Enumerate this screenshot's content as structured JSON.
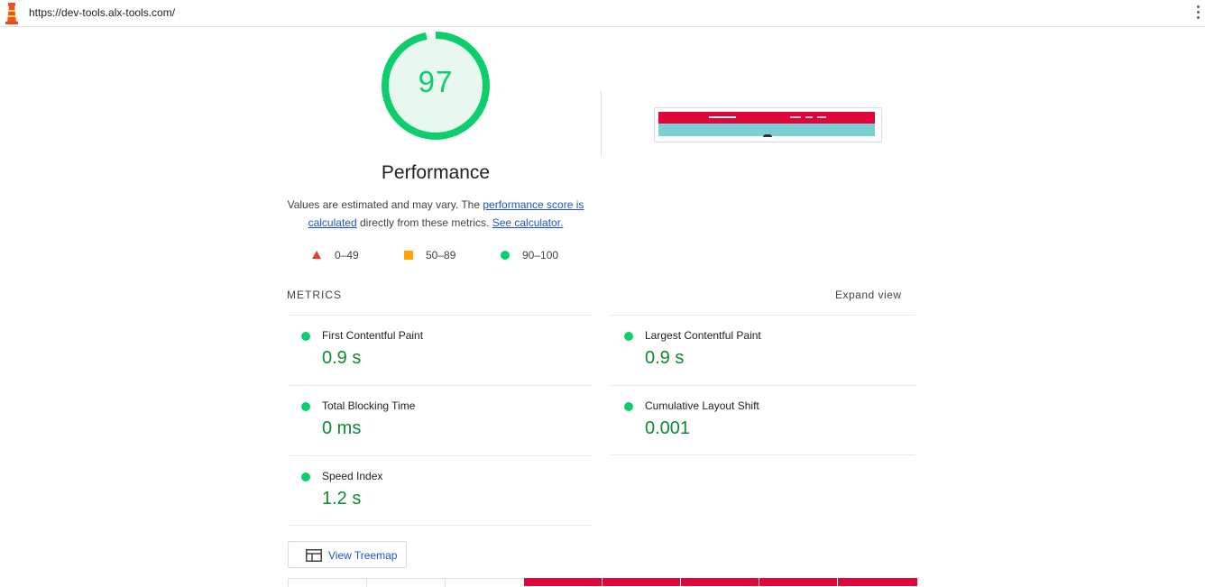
{
  "address_bar": {
    "url": "https://dev-tools.alx-tools.com/"
  },
  "colors": {
    "pass": "#0cce6b",
    "pass_text": "#0c8a33",
    "average": "#ffa400",
    "fail": "#eb3a33",
    "link": "#1a55d0"
  },
  "gauge": {
    "score": "97",
    "score_fraction": 0.97,
    "title": "Performance"
  },
  "description": {
    "lead": "Values are estimated and may vary. The ",
    "link1": "performance score is calculated",
    "middle": " directly from these metrics. ",
    "link2": "See calculator."
  },
  "legend": [
    {
      "icon": "triangle-icon",
      "label": "0–49"
    },
    {
      "icon": "square-icon",
      "label": "50–89"
    },
    {
      "icon": "circle-icon",
      "label": "90–100"
    }
  ],
  "metrics_section": {
    "heading": "METRICS",
    "expand_label": "Expand view",
    "items": [
      {
        "name": "First Contentful Paint",
        "value": "0.9 s"
      },
      {
        "name": "Largest Contentful Paint",
        "value": "0.9 s"
      },
      {
        "name": "Total Blocking Time",
        "value": "0 ms"
      },
      {
        "name": "Cumulative Layout Shift",
        "value": "0.001"
      },
      {
        "name": "Speed Index",
        "value": "1.2 s"
      }
    ]
  },
  "treemap_button": {
    "label": "View Treemap",
    "icon": "treemap-icon"
  }
}
